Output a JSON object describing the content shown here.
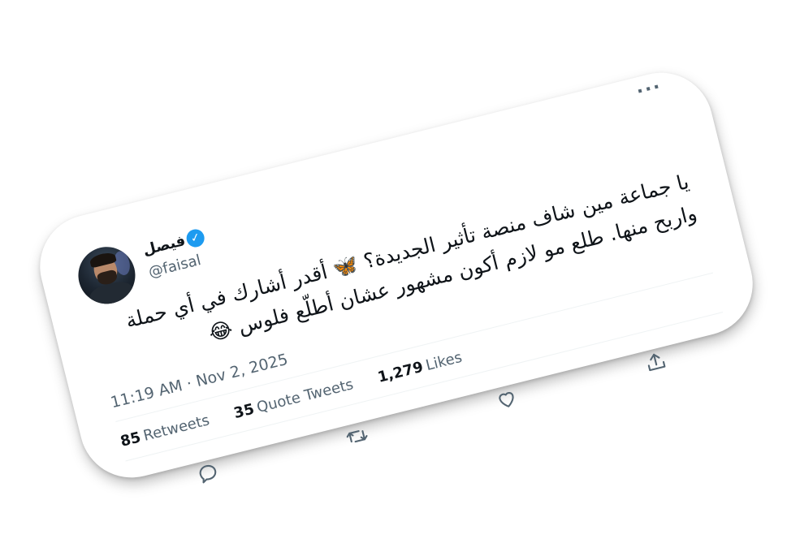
{
  "tweet": {
    "display_name": "فيصل",
    "handle": "@faisal",
    "text": "يا جماعة مين شاف منصة تأثير الجديدة؟ 🦋 أقدر أشارك في أي حملة واربح منها. طلع مو لازم أكون مشهور عشان أطلّع فلوس 😂",
    "time": "11:19 AM · Nov 2, 2025",
    "more_label": "···"
  },
  "stats": {
    "retweets_count": "85",
    "retweets_label": "Retweets",
    "quotes_count": "35",
    "quotes_label": "Quote Tweets",
    "likes_count": "1,279",
    "likes_label": "Likes"
  },
  "actions": {
    "reply": "reply-icon",
    "retweet": "retweet-icon",
    "like": "heart-icon",
    "share": "share-icon"
  },
  "colors": {
    "verified": "#1d9bf0",
    "secondary_text": "#536471",
    "primary_text": "#0f1419",
    "divider": "#eff3f4"
  }
}
